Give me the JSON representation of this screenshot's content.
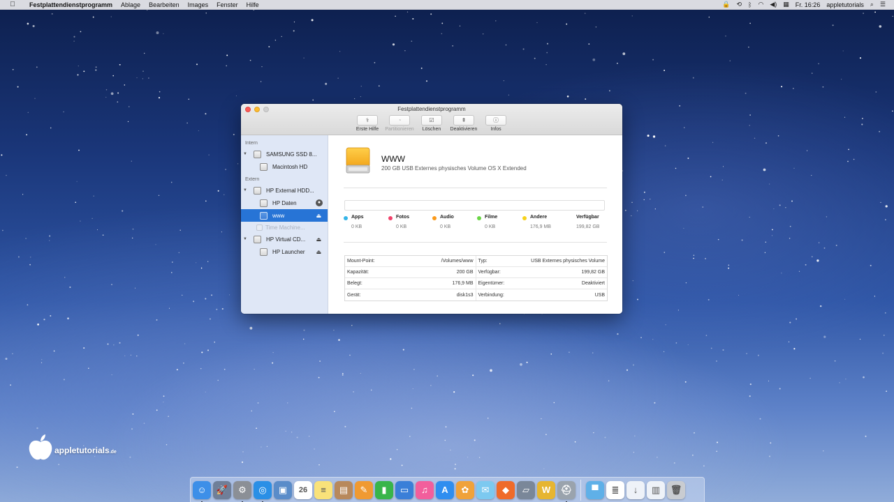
{
  "menubar": {
    "apple_label": "",
    "app_name": "Festplattendienstprogramm",
    "items": [
      "Ablage",
      "Bearbeiten",
      "Images",
      "Fenster",
      "Hilfe"
    ],
    "clock": "Fr. 16:26",
    "user": "appletutorials"
  },
  "window": {
    "title": "Festplattendienstprogramm",
    "toolbar": [
      {
        "label": "Erste Hilfe",
        "icon": "stethoscope-icon",
        "enabled": true
      },
      {
        "label": "Partitionieren",
        "icon": "partition-icon",
        "enabled": false
      },
      {
        "label": "Löschen",
        "icon": "erase-icon",
        "enabled": true
      },
      {
        "label": "Deaktivieren",
        "icon": "unmount-icon",
        "enabled": true
      },
      {
        "label": "Infos",
        "icon": "info-icon",
        "enabled": true
      }
    ]
  },
  "sidebar": {
    "section_intern": "Intern",
    "section_extern": "Extern",
    "items": [
      {
        "label": "SAMSUNG SSD 8..."
      },
      {
        "label": "Macintosh HD"
      },
      {
        "label": "HP External HDD..."
      },
      {
        "label": "HP Daten"
      },
      {
        "label": "www"
      },
      {
        "label": "Time Machine..."
      },
      {
        "label": "HP Virtual CD..."
      },
      {
        "label": "HP Launcher"
      }
    ]
  },
  "volume": {
    "name": "WWW",
    "description": "200 GB USB Externes physisches Volume OS X Extended"
  },
  "legend": [
    {
      "name": "Apps",
      "value": "0 KB",
      "color": "#35b5e8"
    },
    {
      "name": "Fotos",
      "value": "0 KB",
      "color": "#f2426b"
    },
    {
      "name": "Audio",
      "value": "0 KB",
      "color": "#fb9a1a"
    },
    {
      "name": "Filme",
      "value": "0 KB",
      "color": "#6ad645"
    },
    {
      "name": "Andere",
      "value": "176,9 MB",
      "color": "#f7d21b"
    },
    {
      "name": "Verfügbar",
      "value": "199,82 GB",
      "color": ""
    }
  ],
  "properties": [
    {
      "k1": "Mount-Point:",
      "v1": "/Volumes/www",
      "k2": "Typ:",
      "v2": "USB Externes physisches Volume"
    },
    {
      "k1": "Kapazität:",
      "v1": "200 GB",
      "k2": "Verfügbar:",
      "v2": "199,82 GB"
    },
    {
      "k1": "Belegt:",
      "v1": "176,9 MB",
      "k2": "Eigentümer:",
      "v2": "Deaktiviert"
    },
    {
      "k1": "Gerät:",
      "v1": "disk1s3",
      "k2": "Verbindung:",
      "v2": "USB"
    }
  ],
  "logo": {
    "text": "appletutorials",
    "suffix": ".de"
  },
  "dock": [
    {
      "name": "finder",
      "color": "#3d8fe8",
      "glyph": "☺",
      "running": true
    },
    {
      "name": "launchpad",
      "color": "#6f7f99",
      "glyph": "🚀",
      "running": false
    },
    {
      "name": "system-preferences",
      "color": "#8b8f96",
      "glyph": "⚙",
      "running": true
    },
    {
      "name": "safari",
      "color": "#2a8fe6",
      "glyph": "◎",
      "running": true
    },
    {
      "name": "preview",
      "color": "#5a8cc9",
      "glyph": "▣",
      "running": false
    },
    {
      "name": "calendar",
      "color": "#ffffff",
      "glyph": "26",
      "running": false
    },
    {
      "name": "notes",
      "color": "#f9e27a",
      "glyph": "≡",
      "running": false
    },
    {
      "name": "contacts",
      "color": "#b8895c",
      "glyph": "▤",
      "running": false
    },
    {
      "name": "pages",
      "color": "#f09a32",
      "glyph": "✎",
      "running": false
    },
    {
      "name": "numbers",
      "color": "#38b54a",
      "glyph": "▮",
      "running": false
    },
    {
      "name": "keynote",
      "color": "#3a7fd8",
      "glyph": "▭",
      "running": false
    },
    {
      "name": "itunes",
      "color": "#f25e9c",
      "glyph": "♫",
      "running": false
    },
    {
      "name": "app-store",
      "color": "#2f8ef0",
      "glyph": "A",
      "running": false
    },
    {
      "name": "photos",
      "color": "#f0a23a",
      "glyph": "✿",
      "running": false
    },
    {
      "name": "messages",
      "color": "#7cc9f0",
      "glyph": "✉",
      "running": false
    },
    {
      "name": "office",
      "color": "#ef6b2a",
      "glyph": "◆",
      "running": false
    },
    {
      "name": "screenshot",
      "color": "#7a8799",
      "glyph": "▱",
      "running": false
    },
    {
      "name": "mercury",
      "color": "#e6b531",
      "glyph": "W",
      "running": false
    },
    {
      "name": "disk-utility",
      "color": "#9aa3ad",
      "glyph": "⛑",
      "running": true
    },
    {
      "name": "applications-folder",
      "color": "#5fb0e8",
      "glyph": "▀",
      "running": false
    },
    {
      "name": "documents",
      "color": "#ffffff",
      "glyph": "≣",
      "running": false
    },
    {
      "name": "downloads",
      "color": "#eef2f8",
      "glyph": "↓",
      "running": false
    },
    {
      "name": "files",
      "color": "#eef2f8",
      "glyph": "▥",
      "running": false
    },
    {
      "name": "trash",
      "color": "#c9ccd1",
      "glyph": "🗑",
      "running": false
    }
  ]
}
